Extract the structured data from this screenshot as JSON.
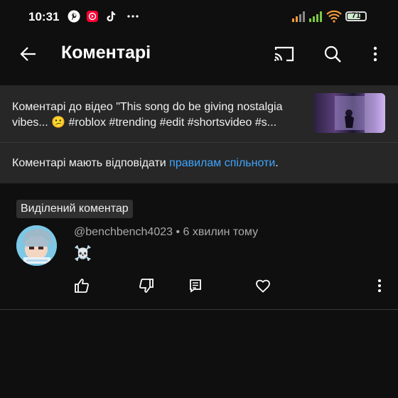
{
  "status_bar": {
    "time": "10:31",
    "left_icons": [
      "pinterest-icon",
      "youtube-music-icon",
      "tiktok-icon",
      "more-dots-icon"
    ],
    "battery_level": "71"
  },
  "app_bar": {
    "title": "Коментарі",
    "back_icon": "arrow-left-icon",
    "actions": [
      "cast-icon",
      "search-icon",
      "more-vert-icon"
    ]
  },
  "video_info": {
    "text": "Коментарі до відео \"This song do be giving nostalgia vibes... 😕 #roblox  #trending #edit #shortsvideo #s..."
  },
  "rules": {
    "prefix": "Коментарі мають відповідати ",
    "link": "правилам спільноти",
    "suffix": "."
  },
  "highlighted_badge": "Виділений коментар",
  "comment": {
    "author": "@benchbench4023",
    "separator": " • ",
    "time": "6 хвилин тому",
    "text": "☠️",
    "actions": [
      "like-icon",
      "dislike-icon",
      "reply-icon",
      "heart-icon",
      "more-vert-icon"
    ]
  },
  "colors": {
    "background": "#0f0f0f",
    "panel": "#272727",
    "link": "#3ea6ff",
    "secondary_text": "#aaaaaa"
  }
}
